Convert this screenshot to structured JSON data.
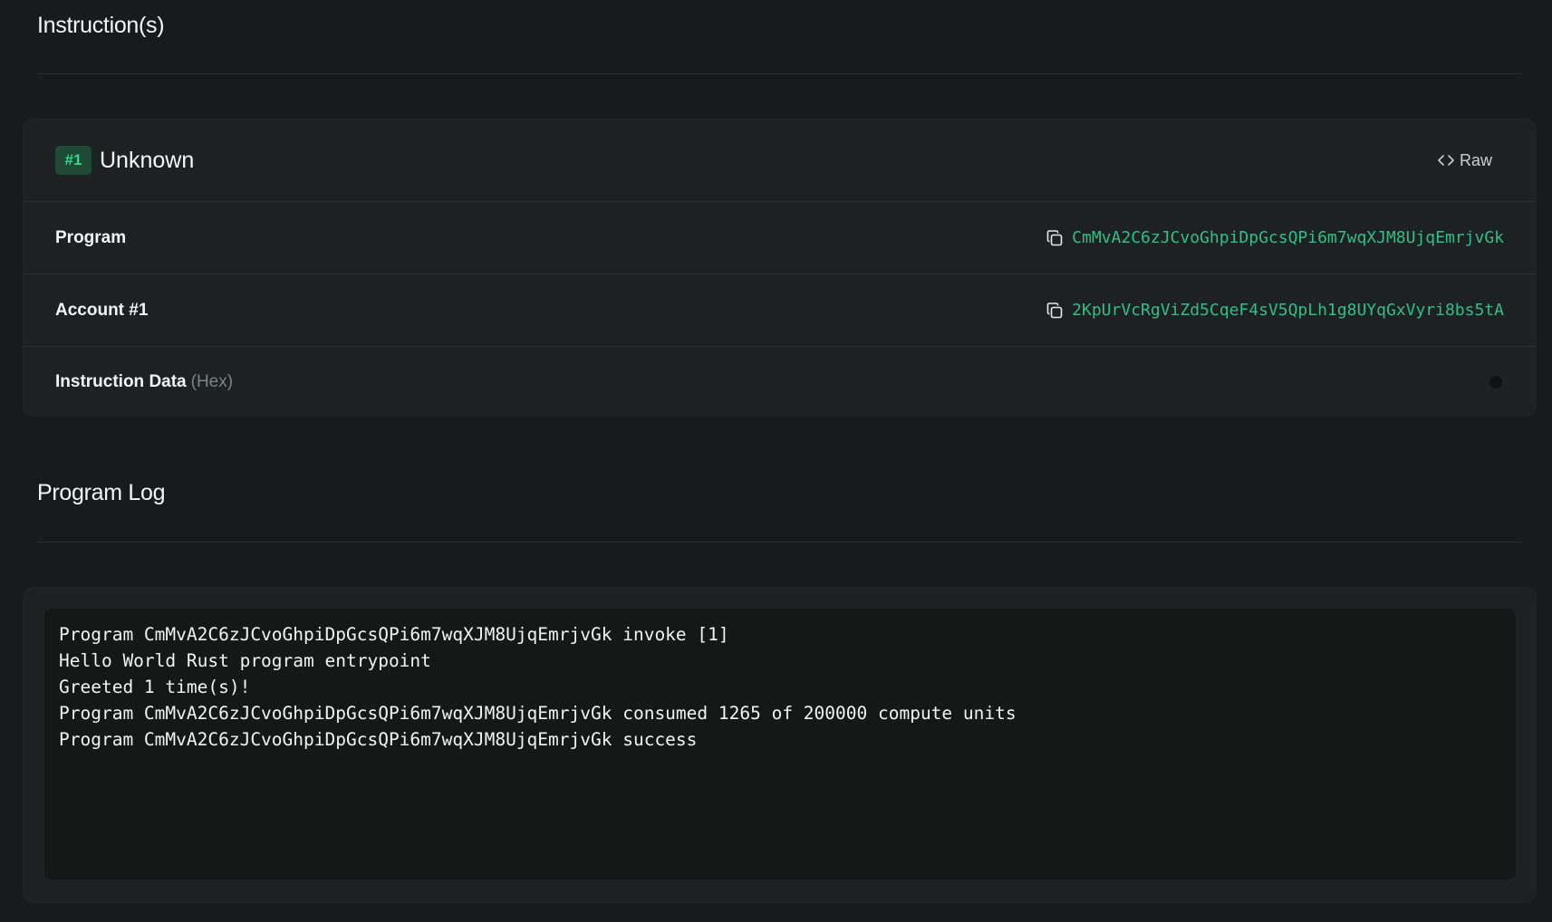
{
  "instructions_section": {
    "title": "Instruction(s)"
  },
  "instruction": {
    "badge": "#1",
    "name": "Unknown",
    "raw_label": "Raw",
    "rows": [
      {
        "label": "Program",
        "value": "CmMvA2C6zJCvoGhpiDpGcsQPi6m7wqXJM8UjqEmrjvGk"
      },
      {
        "label": "Account #1",
        "value": "2KpUrVcRgViZd5CqeF4sV5QpLh1g8UYqGxVyri8bs5tA"
      }
    ],
    "data_row": {
      "label": "Instruction Data",
      "sublabel": "(Hex)"
    }
  },
  "program_log_section": {
    "title": "Program Log",
    "lines": [
      "Program CmMvA2C6zJCvoGhpiDpGcsQPi6m7wqXJM8UjqEmrjvGk invoke [1]",
      "Hello World Rust program entrypoint",
      "Greeted 1 time(s)!",
      "Program CmMvA2C6zJCvoGhpiDpGcsQPi6m7wqXJM8UjqEmrjvGk consumed 1265 of 200000 compute units",
      "Program CmMvA2C6zJCvoGhpiDpGcsQPi6m7wqXJM8UjqEmrjvGk success"
    ]
  },
  "icons": {
    "raw": "code-brackets-icon",
    "copy": "copy-icon"
  },
  "colors": {
    "background": "#181b1b",
    "card": "#1d2121",
    "accent": "#2fbf8a",
    "badge_bg": "#1e4a36",
    "badge_text": "#2dd98b"
  }
}
